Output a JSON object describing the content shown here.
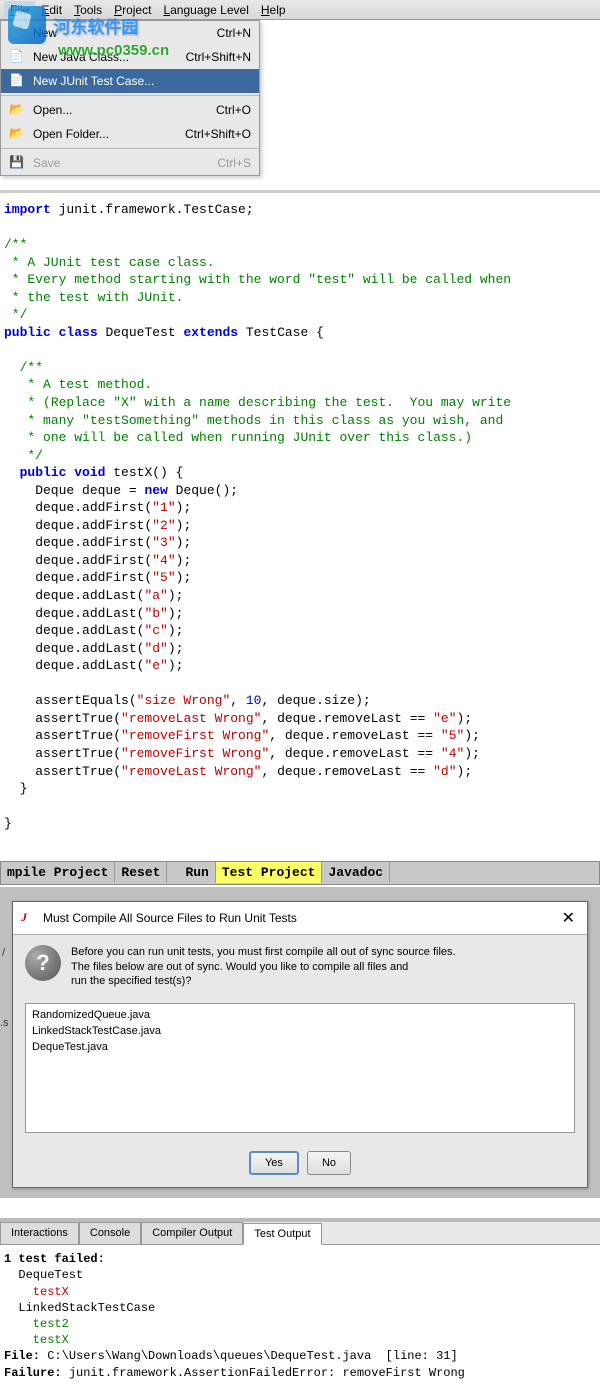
{
  "watermark": {
    "text": "河东软件园",
    "url": "www.pc0359.cn"
  },
  "menubar": [
    {
      "label": "File",
      "u": "F"
    },
    {
      "label": "Edit",
      "u": "E"
    },
    {
      "label": "Tools",
      "u": "T"
    },
    {
      "label": "Project",
      "u": "P"
    },
    {
      "label": "Language Level",
      "u": "L"
    },
    {
      "label": "Help",
      "u": "H"
    }
  ],
  "dropdown": {
    "items": [
      {
        "label": "New",
        "shortcut": "Ctrl+N"
      },
      {
        "label": "New Java Class...",
        "shortcut": "Ctrl+Shift+N"
      },
      {
        "label": "New JUnit Test Case...",
        "shortcut": "",
        "selected": true
      },
      {
        "sep": true
      },
      {
        "label": "Open...",
        "shortcut": "Ctrl+O"
      },
      {
        "label": "Open Folder...",
        "shortcut": "Ctrl+Shift+O"
      },
      {
        "sep": true
      },
      {
        "label": "Save",
        "shortcut": "Ctrl+S",
        "disabled": true
      }
    ]
  },
  "code": {
    "line1_import": "import",
    "line1_rest": " junit.framework.TestCase;",
    "cmt1_1": "/**",
    "cmt1_2": " * A JUnit test case class.",
    "cmt1_3": " * Every method starting with the word \"test\" will be called when",
    "cmt1_4": " * the test with JUnit.",
    "cmt1_5": " */",
    "public": "public",
    "class": "class",
    "extends": "extends",
    "void": "void",
    "new": "new",
    "classname": " DequeTest ",
    "testcase": " TestCase {",
    "cmt2_1": "/**",
    "cmt2_2": " * A test method.",
    "cmt2_3": " * (Replace \"X\" with a name describing the test.  You may write",
    "cmt2_4": " * many \"testSomething\" methods in this class as you wish, and",
    "cmt2_5": " * one will be called when running JUnit over this class.)",
    "cmt2_6": " */",
    "testX": " testX() {",
    "dequeDecl": "    Deque deque = ",
    "dequeNew": " Deque();",
    "af1a": "    deque.addFirst(",
    "af1b": "\"1\"",
    "af1c": ");",
    "af2a": "    deque.addFirst(",
    "af2b": "\"2\"",
    "af2c": ");",
    "af3a": "    deque.addFirst(",
    "af3b": "\"3\"",
    "af3c": ");",
    "af4a": "    deque.addFirst(",
    "af4b": "\"4\"",
    "af4c": ");",
    "af5a": "    deque.addFirst(",
    "af5b": "\"5\"",
    "af5c": ");",
    "al1a": "    deque.addLast(",
    "al1b": "\"a\"",
    "al1c": ");",
    "al2a": "    deque.addLast(",
    "al2b": "\"b\"",
    "al2c": ");",
    "al3a": "    deque.addLast(",
    "al3b": "\"c\"",
    "al3c": ");",
    "al4a": "    deque.addLast(",
    "al4b": "\"d\"",
    "al4c": ");",
    "al5a": "    deque.addLast(",
    "al5b": "\"e\"",
    "al5c": ");",
    "as1a": "    assertEquals(",
    "as1b": "\"size Wrong\"",
    "as1c": ", ",
    "as1n": "10",
    "as1d": ", deque.size);",
    "as2a": "    assertTrue(",
    "as2b": "\"removeLast Wrong\"",
    "as2c": ", deque.removeLast == ",
    "as2d": "\"e\"",
    "as2e": ");",
    "as3a": "    assertTrue(",
    "as3b": "\"removeFirst Wrong\"",
    "as3c": ", deque.removeLast == ",
    "as3d": "\"5\"",
    "as3e": ");",
    "as4a": "    assertTrue(",
    "as4b": "\"removeFirst Wrong\"",
    "as4c": ", deque.removeLast == ",
    "as4d": "\"4\"",
    "as4e": ");",
    "as5a": "    assertTrue(",
    "as5b": "\"removeLast Wrong\"",
    "as5c": ", deque.removeLast == ",
    "as5d": "\"d\"",
    "as5e": ");",
    "closeMethod": "  }",
    "closeClass": "}"
  },
  "toolbar": {
    "b1": "mpile Project",
    "b2": "Reset",
    "b3": "Run",
    "b4": "Test Project",
    "b5": "Javadoc"
  },
  "dialog": {
    "title": "Must Compile All Source Files to Run Unit Tests",
    "msg1": "Before you can run unit tests, you must first compile all out of sync source files.",
    "msg2": "The files below are out of sync. Would you like to compile all files and",
    "msg3": "run the specified test(s)?",
    "files": [
      "RandomizedQueue.java",
      "LinkedStackTestCase.java",
      "DequeTest.java"
    ],
    "yes": "Yes",
    "no": "No",
    "close": "✕",
    "sideA": "/",
    "sideB": ".s"
  },
  "tabs": {
    "t1": "Interactions",
    "t2": "Console",
    "t3": "Compiler Output",
    "t4": "Test Output"
  },
  "output": {
    "l1": "1 test failed:",
    "l2": "  DequeTest",
    "l3": "    testX",
    "l4": "  LinkedStackTestCase",
    "l5": "    test2",
    "l6": "    testX",
    "l7a": "File: ",
    "l7b": "C:\\Users\\Wang\\Downloads\\queues\\DequeTest.java  [line: 31]",
    "l8a": "Failure: ",
    "l8b": "junit.framework.AssertionFailedError: removeFirst Wrong"
  }
}
